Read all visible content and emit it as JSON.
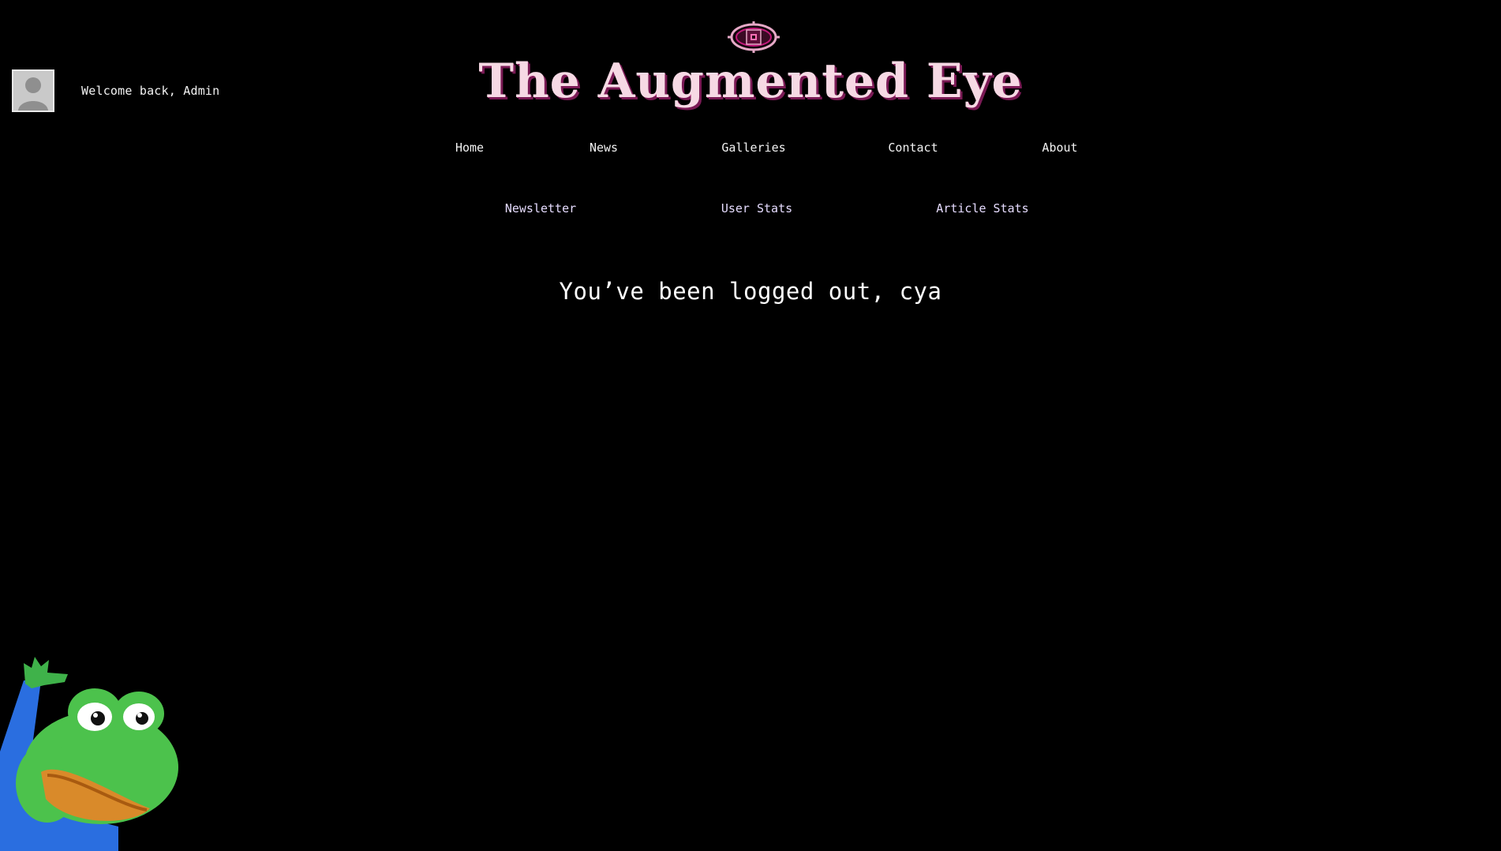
{
  "header": {
    "welcome_text": "Welcome back, Admin",
    "site_title": "The Augmented Eye",
    "logo_icon": "eye-icon"
  },
  "nav": {
    "primary": [
      {
        "label": "Home"
      },
      {
        "label": "News"
      },
      {
        "label": "Galleries"
      },
      {
        "label": "Contact"
      },
      {
        "label": "About"
      }
    ],
    "secondary": [
      {
        "label": "Newsletter"
      },
      {
        "label": "User Stats"
      },
      {
        "label": "Article Stats"
      }
    ]
  },
  "main": {
    "message": "You’ve been logged out, cya"
  },
  "colors": {
    "background": "#000000",
    "title": "#f6d9e4",
    "title_shadow": "#7a1a55",
    "logo_accent": "#c2187a",
    "frog_green": "#4cc24c",
    "frog_arm": "#2a6ee0"
  },
  "decorations": {
    "avatar_icon": "user-silhouette-icon",
    "mascot": "waving-frog"
  }
}
